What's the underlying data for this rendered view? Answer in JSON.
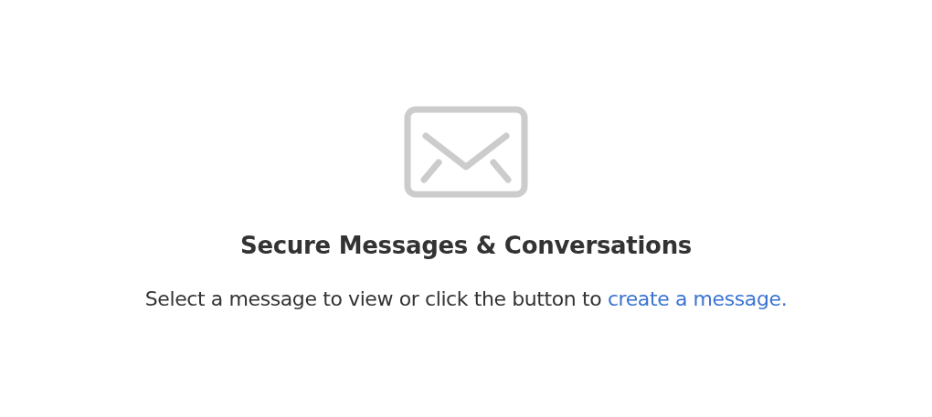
{
  "empty_state": {
    "title": "Secure Messages & Conversations",
    "message": {
      "text": "Select a message to view or click the button to ",
      "link": "create a message."
    }
  }
}
